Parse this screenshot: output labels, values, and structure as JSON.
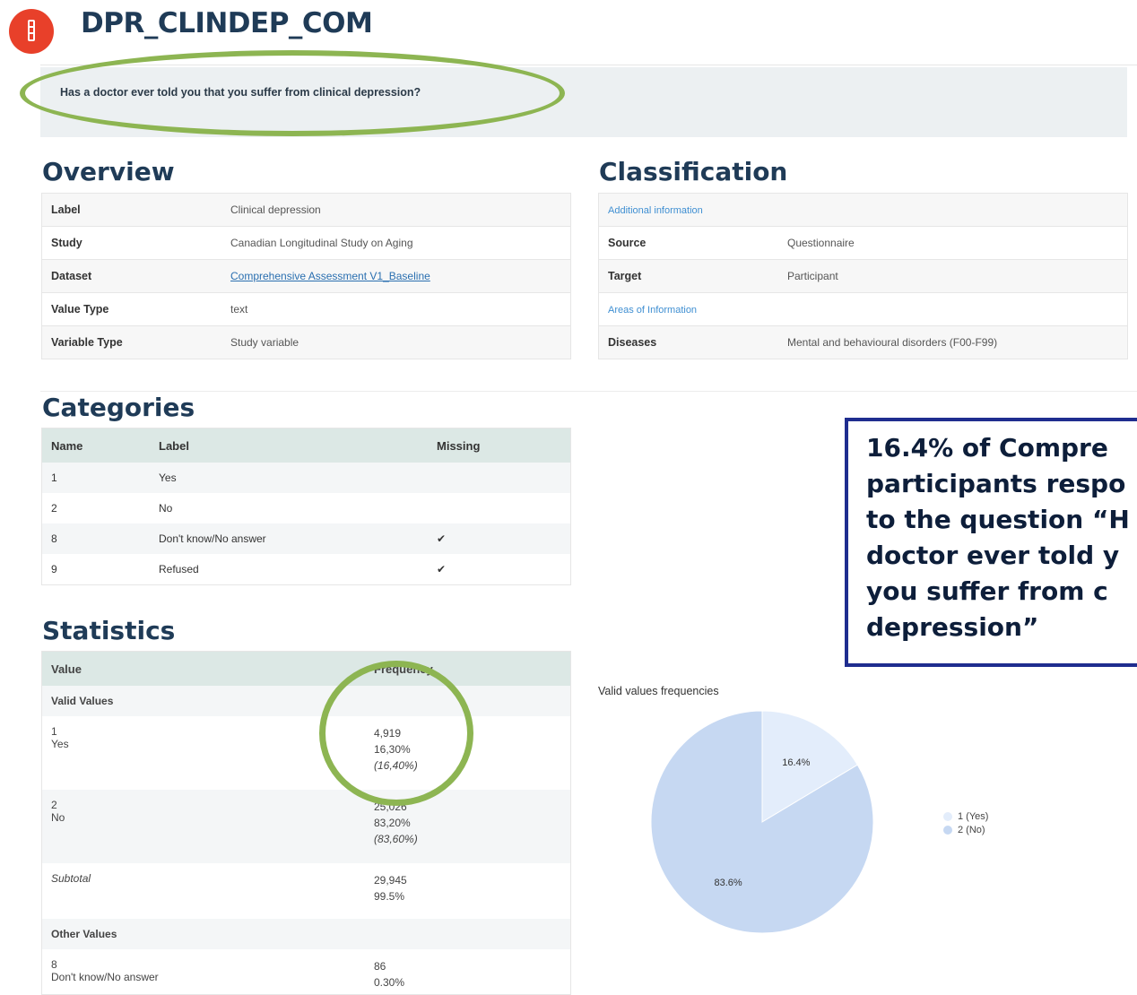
{
  "header": {
    "title": "DPR_CLINDEP_COM",
    "logo_icon": "app-logo-icon"
  },
  "question": "Has a doctor ever told you that you suffer from clinical depression?",
  "overview": {
    "heading": "Overview",
    "rows": [
      {
        "label": "Label",
        "value": "Clinical depression"
      },
      {
        "label": "Study",
        "value": "Canadian Longitudinal Study on Aging"
      },
      {
        "label": "Dataset",
        "value": "Comprehensive Assessment V1_Baseline"
      },
      {
        "label": "Value Type",
        "value": "text"
      },
      {
        "label": "Variable Type",
        "value": "Study variable"
      }
    ]
  },
  "classification": {
    "heading": "Classification",
    "section1": "Additional information",
    "source_label": "Source",
    "source_value": "Questionnaire",
    "target_label": "Target",
    "target_value": "Participant",
    "section2": "Areas of Information",
    "diseases_label": "Diseases",
    "diseases_value": "Mental and behavioural disorders (F00-F99)"
  },
  "categories": {
    "heading": "Categories",
    "columns": [
      "Name",
      "Label",
      "Missing"
    ],
    "rows": [
      {
        "name": "1",
        "label": "Yes",
        "missing": ""
      },
      {
        "name": "2",
        "label": "No",
        "missing": ""
      },
      {
        "name": "8",
        "label": "Don't know/No answer",
        "missing": "✔"
      },
      {
        "name": "9",
        "label": "Refused",
        "missing": "✔"
      }
    ]
  },
  "statistics": {
    "heading": "Statistics",
    "columns": [
      "Value",
      "Frequency"
    ],
    "valid_values_label": "Valid Values",
    "yes": {
      "code": "1",
      "label": "Yes",
      "count": "4,919",
      "pct": "16,30%",
      "valid_pct": "(16,40%)"
    },
    "no": {
      "code": "2",
      "label": "No",
      "count": "25,026",
      "pct": "83,20%",
      "valid_pct": "(83,60%)"
    },
    "subtotal": {
      "label": "Subtotal",
      "count": "29,945",
      "pct": "99.5%"
    },
    "other_values_label": "Other Values",
    "dk": {
      "code": "8",
      "label": "Don't know/No answer",
      "count": "86",
      "pct": "0.30%"
    }
  },
  "callout": "16.4% of Compre\nparticipants respo\nto the question “H\ndoctor ever told y\nyou suffer from c\ndepression”",
  "chart_data": {
    "type": "pie",
    "title": "Valid values frequencies",
    "categories": [
      "1 (Yes)",
      "2 (No)"
    ],
    "values": [
      16.4,
      83.6
    ],
    "labels": [
      "16.4%",
      "83.6%"
    ],
    "colors": [
      "#e3edfb",
      "#c6d8f2"
    ],
    "legend_position": "right"
  }
}
